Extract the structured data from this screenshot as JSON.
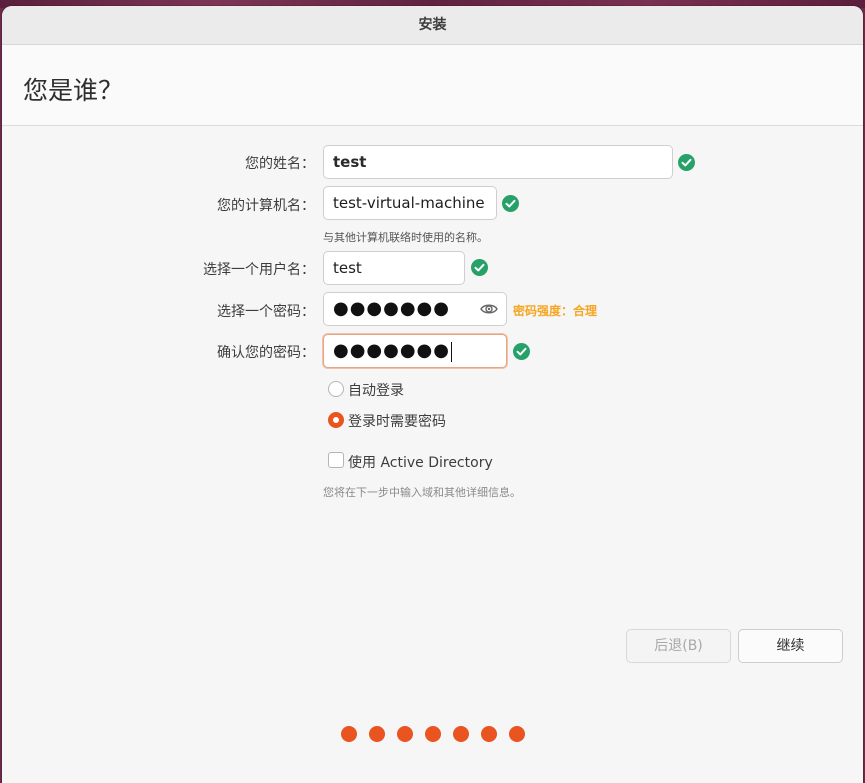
{
  "window": {
    "title": "安装"
  },
  "page": {
    "title": "您是谁？"
  },
  "form": {
    "name": {
      "label": "您的姓名：",
      "value": "test",
      "valid": true
    },
    "computer_name": {
      "label": "您的计算机名：",
      "value": "test-virtual-machine",
      "hint": "与其他计算机联络时使用的名称。",
      "valid": true
    },
    "username": {
      "label": "选择一个用户名：",
      "value": "test",
      "valid": true
    },
    "password": {
      "label": "选择一个密码：",
      "value": "●●●●●●●",
      "strength": "密码强度：合理"
    },
    "confirm_password": {
      "label": "确认您的密码：",
      "value": "●●●●●●●",
      "valid": true
    }
  },
  "login_options": {
    "auto_login": {
      "label": "自动登录",
      "selected": false
    },
    "require_password": {
      "label": "登录时需要密码",
      "selected": true
    }
  },
  "active_directory": {
    "label": "使用 Active Directory",
    "checked": false,
    "hint": "您将在下一步中输入域和其他详细信息。"
  },
  "buttons": {
    "back": "后退(B)",
    "continue": "继续"
  },
  "progress": {
    "total_steps": 7
  },
  "colors": {
    "accent": "#e95420",
    "valid": "#26a269",
    "strength": "#f5a623"
  },
  "icons": {
    "valid": "check-circle-icon",
    "reveal": "eye-icon"
  }
}
